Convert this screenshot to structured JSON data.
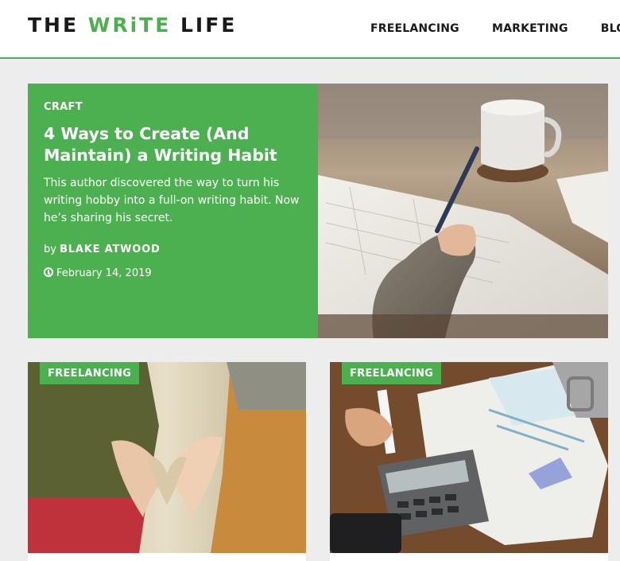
{
  "header": {
    "logo": {
      "part1": "THE ",
      "part2": "WRiTE",
      "part3": " LIFE"
    },
    "nav": [
      "FREELANCING",
      "MARKETING",
      "BLOG"
    ]
  },
  "featured": {
    "category": "CRAFT",
    "title": "4 Ways to Create (And Maintain) a Writing Habit",
    "excerpt": "This author discovered the way to turn his writing hobby into a full-on writing habit. Now he’s sharing his secret.",
    "author_prefix": "by ",
    "author": "BLAKE ATWOOD",
    "date": "February 14, 2019"
  },
  "cards": [
    {
      "category": "FREELANCING"
    },
    {
      "category": "FREELANCING"
    }
  ],
  "colors": {
    "accent": "#4caf50",
    "background": "#ededed",
    "text": "#1a1a1a"
  }
}
